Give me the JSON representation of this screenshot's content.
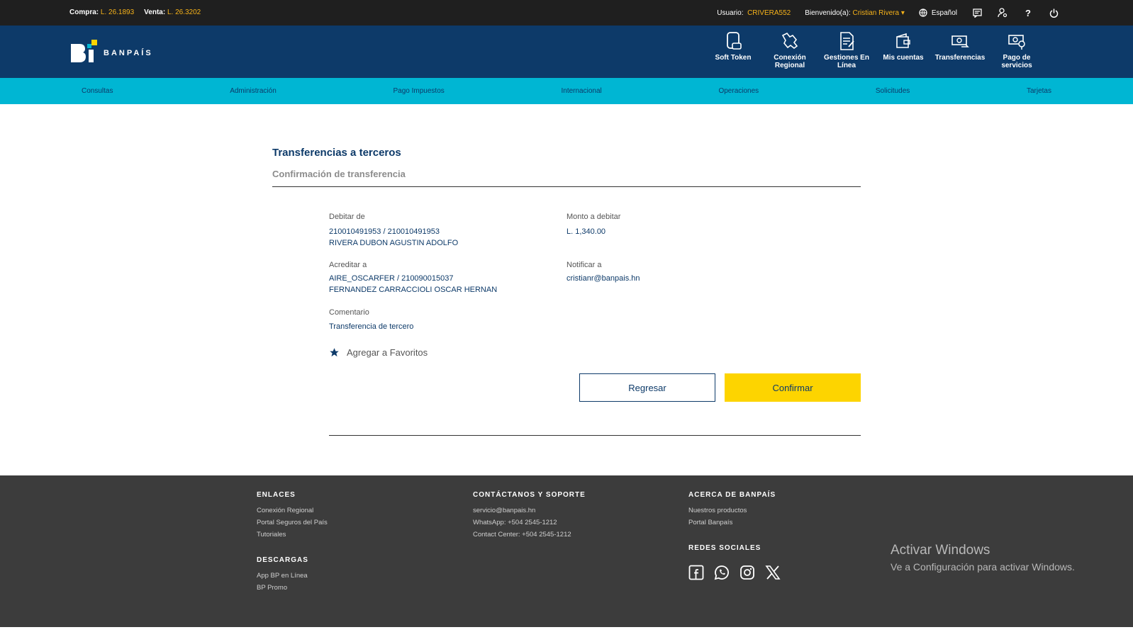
{
  "topbar": {
    "compra_label": "Compra:",
    "compra_value": "L. 26.1893",
    "venta_label": "Venta:",
    "venta_value": "L. 26.3202",
    "usuario_label": "Usuario:",
    "usuario_value": "CRIVERA552",
    "bienvenido_label": "Bienvenido(a):",
    "bienvenido_value": "Cristian Rivera",
    "language": "Español"
  },
  "header": {
    "logo_text": "BANPAÍS",
    "nav": [
      {
        "label": "Soft Token",
        "icon": "soft-token-icon"
      },
      {
        "label": "Conexión Regional",
        "icon": "regional-icon"
      },
      {
        "label": "Gestiones En Línea",
        "icon": "gestiones-icon"
      },
      {
        "label": "Mis cuentas",
        "icon": "wallet-icon"
      },
      {
        "label": "Transferencias",
        "icon": "transfer-icon"
      },
      {
        "label": "Pago de servicios",
        "icon": "payment-icon"
      }
    ]
  },
  "menu": [
    "Consultas",
    "Administración",
    "Pago Impuestos",
    "Internacional",
    "Operaciones",
    "Solicitudes",
    "Tarjetas"
  ],
  "page": {
    "title": "Transferencias a terceros",
    "subtitle": "Confirmación de transferencia"
  },
  "details": {
    "debitar_label": "Debitar de",
    "debitar_line1": "210010491953 / 210010491953",
    "debitar_line2": "RIVERA DUBON AGUSTIN ADOLFO",
    "monto_label": "Monto a debitar",
    "monto_value": "L. 1,340.00",
    "acreditar_label": "Acreditar a",
    "acreditar_line1": "AIRE_OSCARFER / 210090015037",
    "acreditar_line2": "FERNANDEZ CARRACCIOLI OSCAR HERNAN",
    "notificar_label": "Notificar a",
    "notificar_value": "cristianr@banpais.hn",
    "comentario_label": "Comentario",
    "comentario_value": "Transferencia de tercero",
    "favoritos_label": "Agregar a Favoritos"
  },
  "buttons": {
    "back": "Regresar",
    "confirm": "Confirmar"
  },
  "footer": {
    "enlaces_title": "ENLACES",
    "enlaces": [
      "Conexión Regional",
      "Portal Seguros del País",
      "Tutoriales"
    ],
    "descargas_title": "DESCARGAS",
    "descargas": [
      "App BP en Línea",
      "BP Promo"
    ],
    "contacto_title": "CONTÁCTANOS Y SOPORTE",
    "contacto": [
      "servicio@banpais.hn",
      "WhatsApp: +504 2545-1212",
      "Contact Center: +504 2545-1212"
    ],
    "acerca_title": "ACERCA DE BANPAÍS",
    "acerca": [
      "Nuestros productos",
      "Portal Banpaís"
    ],
    "redes_title": "REDES SOCIALES"
  },
  "watermark": {
    "line1": "Activar Windows",
    "line2": "Ve a Configuración para activar Windows."
  },
  "colors": {
    "navy": "#0d3a69",
    "cyan": "#00b6d3",
    "yellow": "#fdd400",
    "gold": "#f6b21a",
    "footer": "#3c3c3c"
  }
}
